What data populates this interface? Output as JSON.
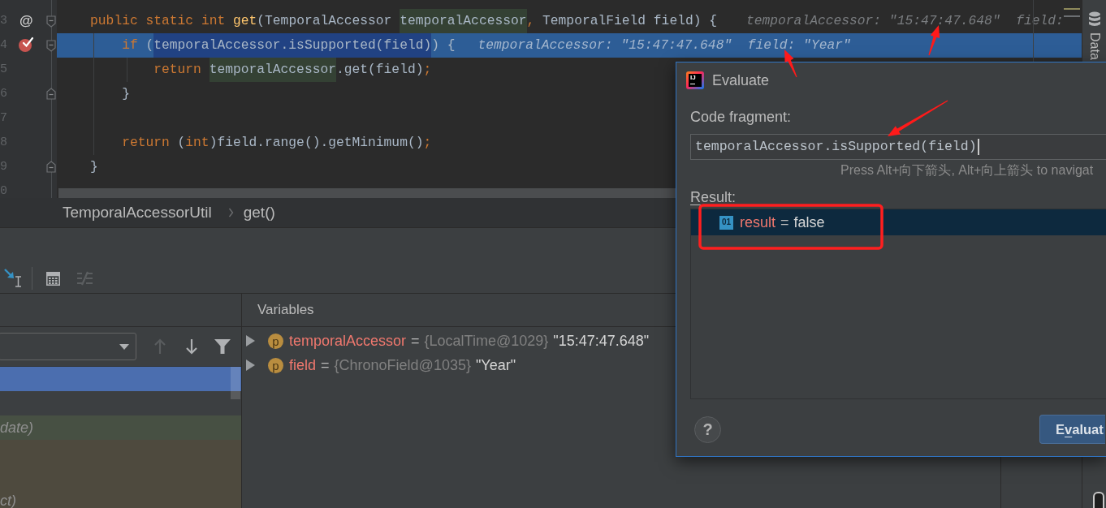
{
  "editor": {
    "lines": [
      {
        "number": "3",
        "gutter_mark": "@",
        "breakpoint": false,
        "fold_start": true,
        "fold_end": false,
        "current": false,
        "tokens": [
          {
            "text": "public",
            "kind": "keyword"
          },
          {
            "text": " static",
            "kind": "keyword"
          },
          {
            "text": " int",
            "kind": "keyword"
          },
          {
            "text": " get",
            "kind": "method"
          },
          {
            "text": "(TemporalAccessor ",
            "kind": "plain"
          },
          {
            "text": "temporalAccessor",
            "kind": "usage"
          },
          {
            "text": ",",
            "kind": "punct"
          },
          {
            "text": " TemporalField field) {",
            "kind": "plain"
          }
        ],
        "hint": "temporalAccessor: \"15:47:47.648\"  field:",
        "children": [
          {
            "number": "4",
            "breakpoint": true,
            "fold_start": true,
            "fold_end": false,
            "current": true,
            "tokens": [
              {
                "text": "if",
                "kind": "keyword"
              },
              {
                "text": " (",
                "kind": "plain"
              },
              {
                "text": "temporalAccessor.isSupported(field)",
                "kind": "selection"
              },
              {
                "text": ") {",
                "kind": "plain"
              }
            ],
            "hint": "temporalAccessor: \"15:47:47.648\"  field: \"Year\"",
            "children": [
              {
                "number": "5",
                "breakpoint": false,
                "fold_start": false,
                "fold_end": false,
                "current": false,
                "tokens": [
                  {
                    "text": "return ",
                    "kind": "keyword"
                  },
                  {
                    "text": "temporalAccessor",
                    "kind": "usage"
                  },
                  {
                    "text": ".get(field)",
                    "kind": "plain"
                  },
                  {
                    "text": ";",
                    "kind": "punct"
                  }
                ]
              }
            ]
          },
          {
            "number": "6",
            "breakpoint": false,
            "fold_start": false,
            "fold_end": true,
            "current": false,
            "tokens": [
              {
                "text": "}",
                "kind": "plain"
              }
            ]
          },
          {
            "number": "7",
            "breakpoint": false,
            "fold_start": false,
            "fold_end": false,
            "current": false
          },
          {
            "number": "8",
            "breakpoint": false,
            "fold_start": false,
            "fold_end": false,
            "current": false,
            "tokens": [
              {
                "text": "return",
                "kind": "keyword"
              },
              {
                "text": " (",
                "kind": "plain"
              },
              {
                "text": "int",
                "kind": "keyword"
              },
              {
                "text": ")field.range().getMinimum()",
                "kind": "plain"
              },
              {
                "text": ";",
                "kind": "punct"
              }
            ]
          }
        ]
      },
      {
        "number": "9",
        "breakpoint": false,
        "fold_start": false,
        "fold_end": true,
        "current": false,
        "tokens": [
          {
            "text": "}",
            "kind": "plain"
          }
        ]
      },
      {
        "number": "0",
        "breakpoint": false,
        "fold_start": false,
        "fold_end": false,
        "current": false
      }
    ]
  },
  "breadcrumbs": [
    "TemporalAccessorUtil",
    "get()"
  ],
  "tool_strip": [
    {
      "label": "Data"
    }
  ],
  "debug_toolbar": [
    {
      "kind": "run_to_cursor",
      "disabled": false
    },
    {
      "kind": "separator"
    },
    {
      "kind": "evaluate",
      "disabled": false
    },
    {
      "kind": "trace",
      "disabled": true
    }
  ],
  "frames": {
    "thread_dropdown": {
      "expanded": false
    },
    "toolbar": [
      {
        "kind": "up",
        "disabled": true
      },
      {
        "kind": "down",
        "disabled": false
      },
      {
        "kind": "filter",
        "disabled": false
      }
    ],
    "rows": [
      {
        "selected": true
      },
      {
        "selected": false
      },
      {
        "selected": false,
        "text": "date)",
        "color": "#475043"
      },
      {
        "selected": false,
        "color": "#4e4a3e"
      },
      {
        "selected": false,
        "color": "#4e4a3e"
      },
      {
        "selected": false,
        "text": "ct)",
        "color": "#4e4a3e"
      }
    ]
  },
  "variables": {
    "title": "Variables",
    "items": [
      {
        "expanded": false,
        "marker": "p",
        "name": "temporalAccessor",
        "operator": "=",
        "type": "{LocalTime@1029}",
        "value": "\"15:47:47.648\""
      },
      {
        "expanded": false,
        "marker": "p",
        "name": "field",
        "operator": "=",
        "type": "{ChronoField@1035}",
        "value": "\"Year\""
      }
    ]
  },
  "evaluate_dialog": {
    "logo": "IJ",
    "title": "Evaluate",
    "code_label": "Code fragment:",
    "code": "temporalAccessor.isSupported(field)",
    "hint": "Press Alt+向下箭头, Alt+向上箭头 to navigat",
    "result_label": {
      "mnemonic": "R",
      "after": "esult:"
    },
    "result": {
      "selected": true,
      "marker": "01",
      "name": "result",
      "operator": "=",
      "value": "false"
    },
    "help": "?",
    "evaluate_button": {
      "before": "E",
      "mnemonic": "v",
      "after": "aluat"
    }
  },
  "annotations": [
    {
      "kind": "arrow"
    },
    {
      "kind": "arrow"
    },
    {
      "kind": "arrow"
    },
    {
      "kind": "frame"
    }
  ]
}
